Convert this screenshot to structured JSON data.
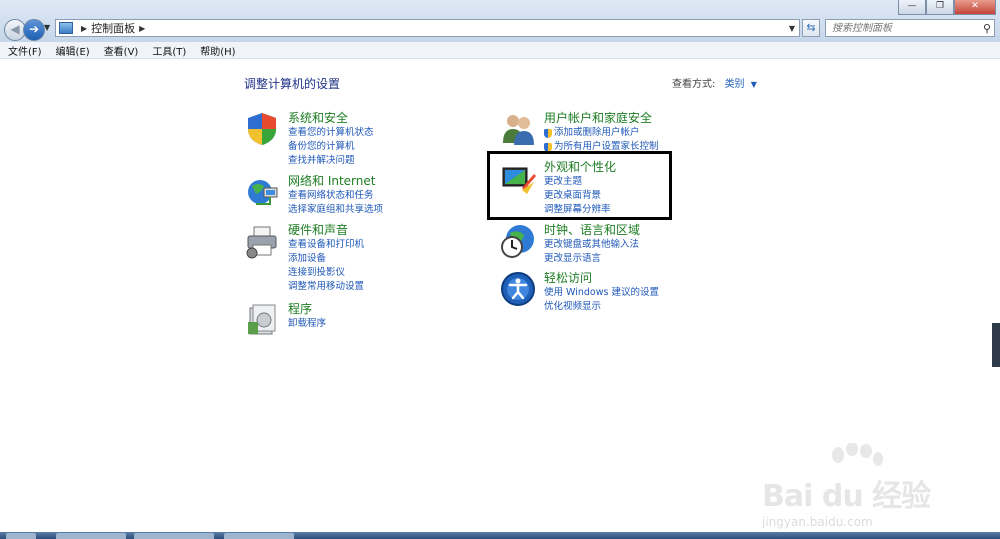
{
  "address_bar": {
    "breadcrumb": "控制面板",
    "search_placeholder": "搜索控制面板"
  },
  "menu": [
    "文件(F)",
    "编辑(E)",
    "查看(V)",
    "工具(T)",
    "帮助(H)"
  ],
  "page": {
    "title": "调整计算机的设置",
    "view_by_label": "查看方式:",
    "view_by_value": "类别"
  },
  "left_categories": [
    {
      "title": "系统和安全",
      "icon": "shield-icon",
      "links": [
        "查看您的计算机状态",
        "备份您的计算机",
        "查找并解决问题"
      ]
    },
    {
      "title": "网络和 Internet",
      "icon": "network-icon",
      "links": [
        "查看网络状态和任务",
        "选择家庭组和共享选项"
      ]
    },
    {
      "title": "硬件和声音",
      "icon": "printer-icon",
      "links": [
        "查看设备和打印机",
        "添加设备",
        "连接到投影仪",
        "调整常用移动设置"
      ]
    },
    {
      "title": "程序",
      "icon": "programs-icon",
      "links": [
        "卸载程序"
      ]
    }
  ],
  "right_categories": [
    {
      "title": "用户帐户和家庭安全",
      "icon": "users-icon",
      "links": [
        "添加或删除用户帐户",
        "为所有用户设置家长控制"
      ]
    },
    {
      "title": "外观和个性化",
      "icon": "appearance-icon",
      "links": [
        "更改主题",
        "更改桌面背景",
        "调整屏幕分辨率"
      ]
    },
    {
      "title": "时钟、语言和区域",
      "icon": "clock-globe-icon",
      "links": [
        "更改键盘或其他输入法",
        "更改显示语言"
      ]
    },
    {
      "title": "轻松访问",
      "icon": "ease-of-access-icon",
      "links": [
        "使用 Windows 建议的设置",
        "优化视频显示"
      ]
    }
  ],
  "watermark": {
    "brand": "Bai du 经验",
    "url": "jingyan.baidu.com"
  }
}
